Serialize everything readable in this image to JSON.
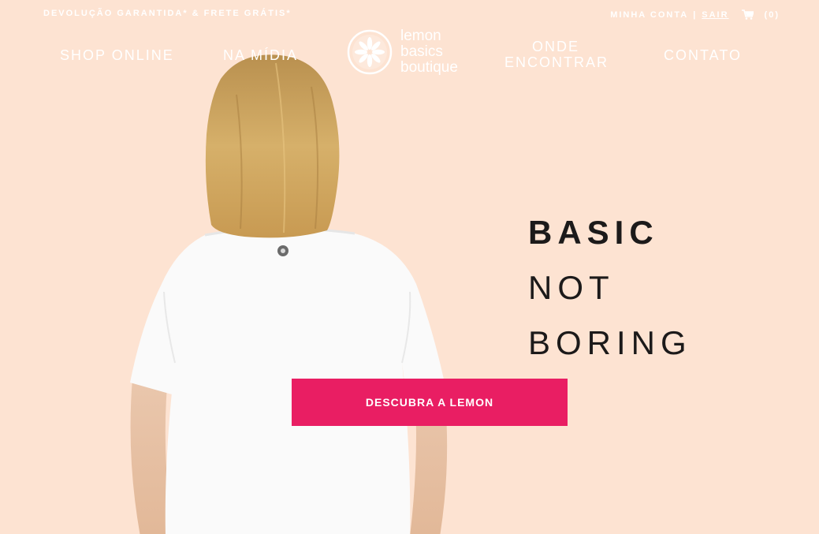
{
  "topbar": {
    "promo_text": "DEVOLUÇÃO GARANTIDA* & FRETE GRÁTIS*",
    "account_label": "MINHA CONTA",
    "separator": "|",
    "logout_label": "SAIR",
    "cart_icon": "shopping-cart-icon",
    "cart_count": "(0)"
  },
  "nav": {
    "shop_online": "SHOP ONLINE",
    "na_midia": "NA MÍDIA",
    "onde_encontrar_line1": "ONDE",
    "onde_encontrar_line2": "ENCONTRAR",
    "contato": "CONTATO"
  },
  "logo": {
    "icon": "lemon-slice-icon",
    "line1": "lemon",
    "line2": "basics",
    "line3": "boutique"
  },
  "hero": {
    "tagline_1": "BASIC",
    "tagline_2": "NOT",
    "tagline_3": "BORING",
    "cta_label": "DESCUBRA A LEMON"
  },
  "colors": {
    "background": "#fde3d2",
    "accent": "#e91e63",
    "text_dark": "#1c1a1a",
    "nav_text": "#ffffff"
  }
}
